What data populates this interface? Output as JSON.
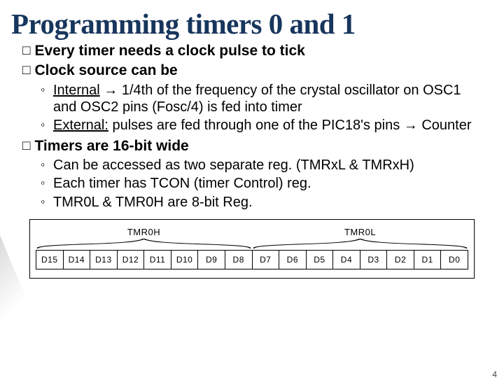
{
  "title": "Programming timers 0 and 1",
  "bullets": {
    "b1_prefix": "Every",
    "b1_rest": " timer needs a clock pulse to tick",
    "b2_prefix": "Clock",
    "b2_rest": " source can be",
    "b3_prefix": "Timers",
    "b3_rest": " are 16-bit wide"
  },
  "sub1": {
    "s1a_u": "Internal",
    "s1a_rest": " → 1/4th of the frequency of the crystal oscillator on OSC1 and OSC2 pins (Fosc/4) is fed into timer",
    "s1b_u": "External:",
    "s1b_rest": " pulses are fed through one of the PIC18's pins → Counter"
  },
  "sub2": {
    "s2a": "Can be accessed as two separate reg. (TMRxL & TMRxH)",
    "s2b": "Each timer has TCON (timer Control) reg.",
    "s2c": "TMR0L & TMR0H are 8-bit Reg."
  },
  "diagram": {
    "label_left": "TMR0H",
    "label_right": "TMR0L",
    "bits": [
      "D15",
      "D14",
      "D13",
      "D12",
      "D11",
      "D10",
      "D9",
      "D8",
      "D7",
      "D6",
      "D5",
      "D4",
      "D3",
      "D2",
      "D1",
      "D0"
    ]
  },
  "page_number": "4"
}
